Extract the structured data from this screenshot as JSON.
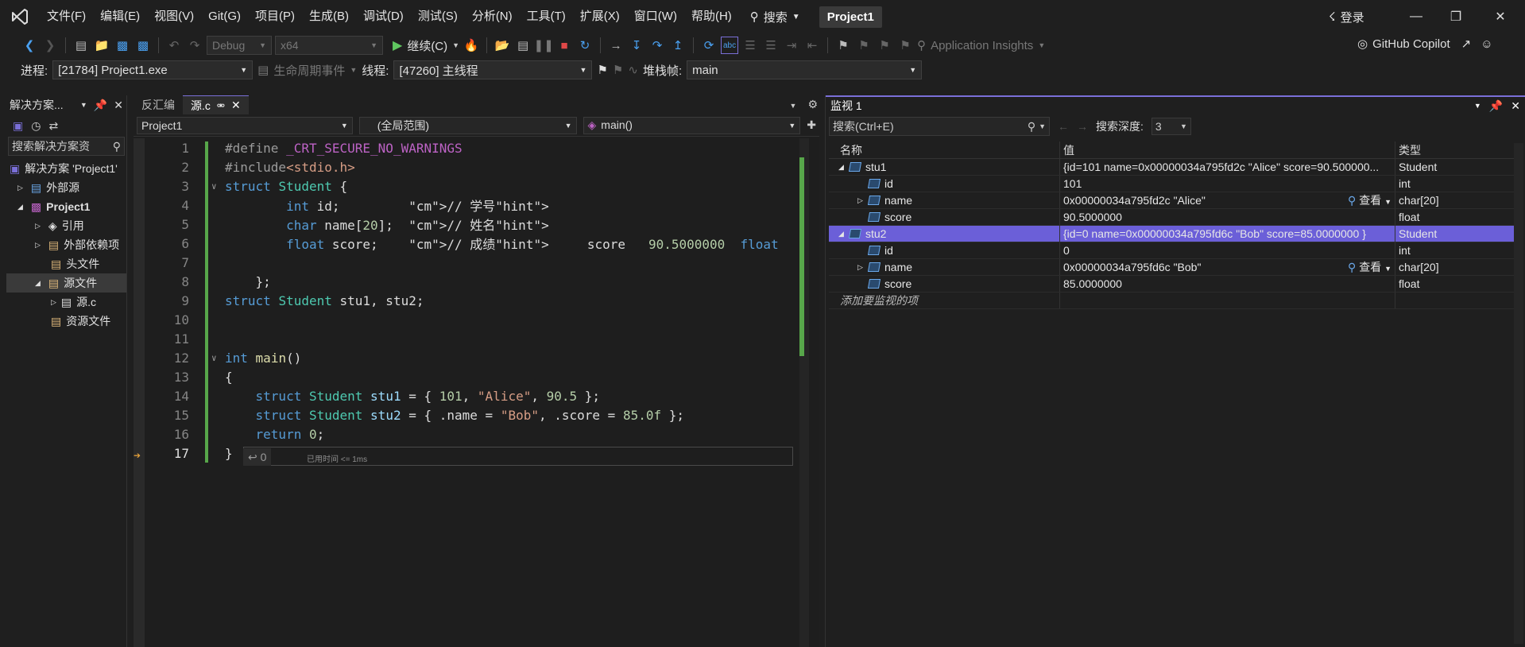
{
  "menu": {
    "items": [
      "文件(F)",
      "编辑(E)",
      "视图(V)",
      "Git(G)",
      "项目(P)",
      "生成(B)",
      "调试(D)",
      "测试(S)",
      "分析(N)",
      "工具(T)",
      "扩展(X)",
      "窗口(W)",
      "帮助(H)"
    ],
    "search_label": "搜索",
    "project": "Project1",
    "login": "登录"
  },
  "toolbar1": {
    "config": "Debug",
    "platform": "x64",
    "continue": "继续(C)",
    "app_insights": "Application Insights",
    "copilot": "GitHub Copilot"
  },
  "toolbar2": {
    "process_label": "进程:",
    "process": "[21784] Project1.exe",
    "lifecycle": "生命周期事件",
    "thread_label": "线程:",
    "thread": "[47260] 主线程",
    "stack_label": "堆栈帧:",
    "stack": "main"
  },
  "solution": {
    "title": "解决方案...",
    "search": "搜索解决方案资",
    "items": [
      "解决方案 'Project1'",
      "外部源",
      "Project1",
      "引用",
      "外部依赖项",
      "头文件",
      "源文件",
      "源.c",
      "资源文件"
    ]
  },
  "editor": {
    "tabs": [
      "反汇编",
      "源.c"
    ],
    "nav_project": "Project1",
    "nav_scope": "(全局范围)",
    "nav_func": "main()",
    "elapsed": "已用时间 <= 1ms",
    "return_hint": "↩ 0"
  },
  "code": [
    {
      "n": "1",
      "t": "#define _CRT_SECURE_NO_WARNINGS"
    },
    {
      "n": "2",
      "t": "#include<stdio.h>"
    },
    {
      "n": "3",
      "t": "struct Student {"
    },
    {
      "n": "4",
      "t": "        int id;         // 学号"
    },
    {
      "n": "5",
      "t": "        char name[20];  // 姓名"
    },
    {
      "n": "6",
      "t": "        float score;    // 成绩     score   90.5000000  float"
    },
    {
      "n": "7",
      "t": ""
    },
    {
      "n": "8",
      "t": "    };"
    },
    {
      "n": "9",
      "t": "struct Student stu1, stu2;"
    },
    {
      "n": "10",
      "t": ""
    },
    {
      "n": "11",
      "t": ""
    },
    {
      "n": "12",
      "t": "int main()"
    },
    {
      "n": "13",
      "t": "{"
    },
    {
      "n": "14",
      "t": "    struct Student stu1 = { 101, \"Alice\", 90.5 };"
    },
    {
      "n": "15",
      "t": "    struct Student stu2 = { .name = \"Bob\", .score = 85.0f };"
    },
    {
      "n": "16",
      "t": "    return 0;"
    },
    {
      "n": "17",
      "t": "}"
    }
  ],
  "watch": {
    "title": "监视 1",
    "search": "搜索(Ctrl+E)",
    "depth_label": "搜索深度:",
    "depth": "3",
    "cols": [
      "名称",
      "值",
      "类型"
    ],
    "rows": [
      {
        "name": "stu1",
        "value": "{id=101 name=0x00000034a795fd2c \"Alice\" score=90.500000...",
        "type": "Student",
        "lvl": 0,
        "exp": "open"
      },
      {
        "name": "id",
        "value": "101",
        "type": "int",
        "lvl": 1,
        "exp": ""
      },
      {
        "name": "name",
        "value": "0x00000034a795fd2c \"Alice\"",
        "type": "char[20]",
        "lvl": 1,
        "exp": "closed",
        "view": "查看"
      },
      {
        "name": "score",
        "value": "90.5000000",
        "type": "float",
        "lvl": 1,
        "exp": ""
      },
      {
        "name": "stu2",
        "value": "{id=0 name=0x00000034a795fd6c \"Bob\" score=85.0000000 }",
        "type": "Student",
        "lvl": 0,
        "exp": "open"
      },
      {
        "name": "id",
        "value": "0",
        "type": "int",
        "lvl": 1,
        "exp": ""
      },
      {
        "name": "name",
        "value": "0x00000034a795fd6c \"Bob\"",
        "type": "char[20]",
        "lvl": 1,
        "exp": "closed",
        "view": "查看"
      },
      {
        "name": "score",
        "value": "85.0000000",
        "type": "float",
        "lvl": 1,
        "exp": ""
      }
    ],
    "add_hint": "添加要监视的项"
  }
}
